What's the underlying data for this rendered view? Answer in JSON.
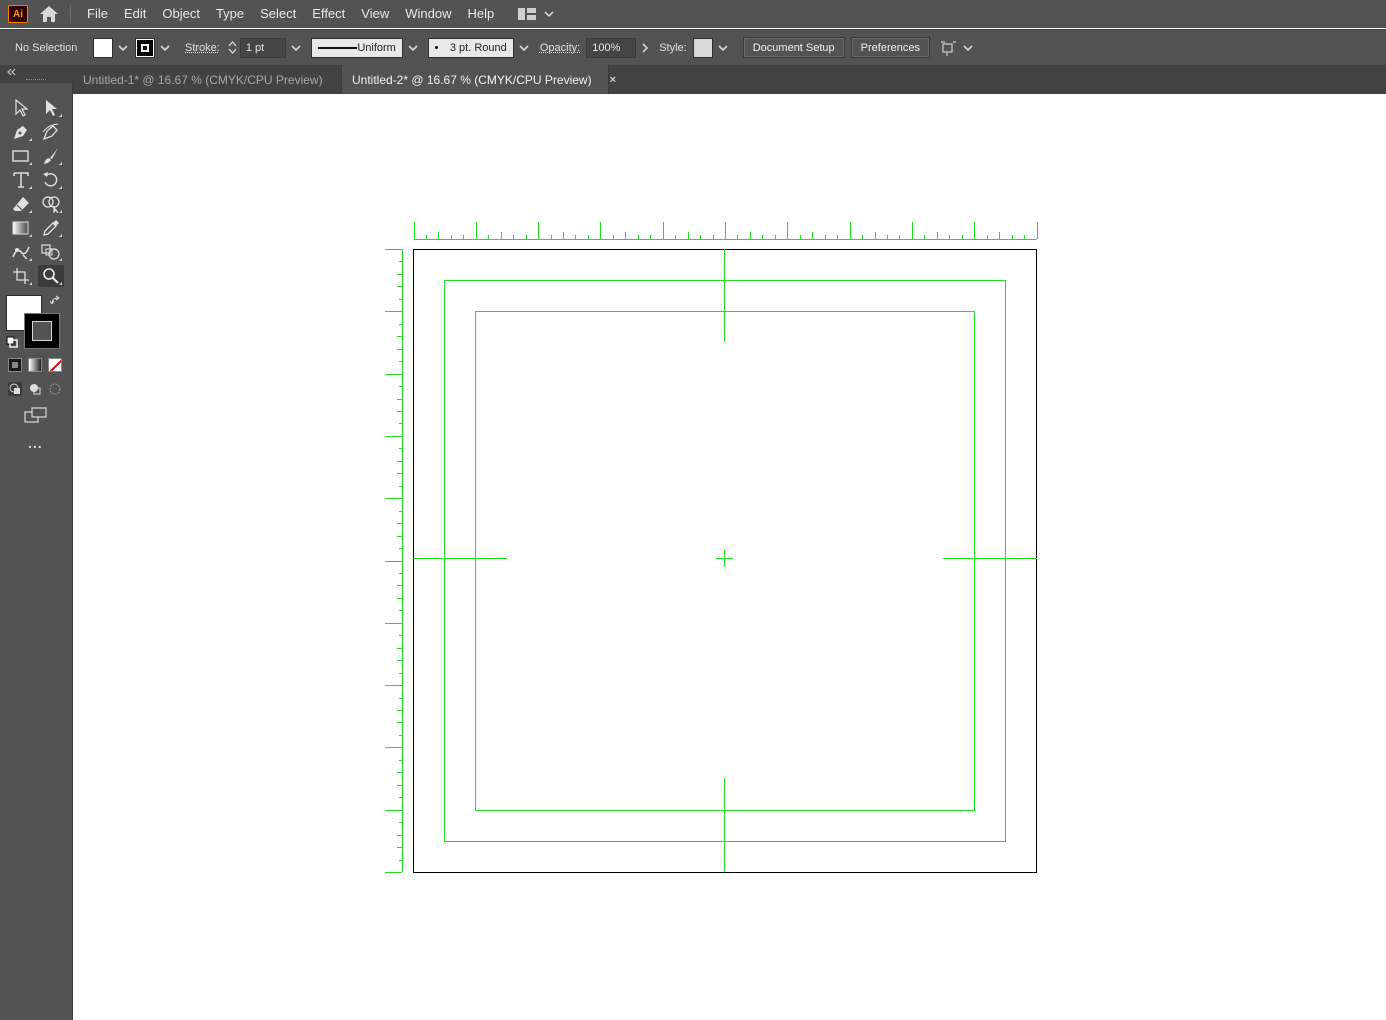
{
  "app": {
    "logo_text": "Ai",
    "brand_color": "#ff9a00"
  },
  "menu": {
    "items": [
      "File",
      "Edit",
      "Object",
      "Type",
      "Select",
      "Effect",
      "View",
      "Window",
      "Help"
    ]
  },
  "control_bar": {
    "selection_status": "No Selection",
    "stroke_label": "Stroke:",
    "stroke_weight": "1 pt",
    "profile_label": "Uniform",
    "brush_label": "3 pt. Round",
    "opacity_label": "Opacity:",
    "opacity_value": "100%",
    "style_label": "Style:",
    "document_setup_label": "Document Setup",
    "preferences_label": "Preferences"
  },
  "tabs": [
    {
      "label": "Untitled-1* @ 16.67 % (CMYK/CPU Preview)",
      "close": "×",
      "active": false
    },
    {
      "label": "Untitled-2* @ 16.67 % (CMYK/CPU Preview)",
      "close": "×",
      "active": true
    }
  ],
  "toolbar": {
    "tools": [
      "selection-tool",
      "direct-selection-tool",
      "pen-tool",
      "curvature-tool",
      "rectangle-tool",
      "paintbrush-tool",
      "type-tool",
      "rotate-tool",
      "eraser-tool",
      "shape-builder-tool",
      "gradient-tool",
      "eyedropper-tool",
      "puppet-warp-tool",
      "blend-tool",
      "artboard-tool",
      "zoom-tool"
    ],
    "active_tool": "zoom-tool",
    "more_label": "..."
  },
  "colors": {
    "guide_green": "#22dd22",
    "ui_dark": "#535353",
    "canvas": "#ffffff"
  }
}
